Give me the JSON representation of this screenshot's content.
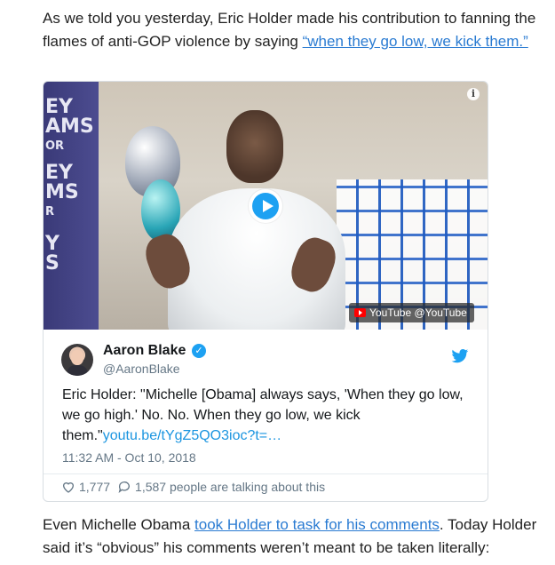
{
  "article": {
    "p1_before": "As we told you yesterday, Eric Holder made his contribution to fanning the flames of anti-GOP violence by saying ",
    "p1_link": "“when they go low, we kick them.”",
    "p2_before": "Even Michelle Obama ",
    "p2_link": "took Holder to task for his comments",
    "p2_after": ". Today Holder said it’s “obvious” his comments weren’t meant to be taken literally:"
  },
  "video": {
    "banner_lines": [
      "EY",
      "AMS",
      "OR",
      "EY",
      "MS",
      "R",
      "Y",
      "S"
    ],
    "youtube_label": "YouTube @YouTube",
    "info_glyph": "i"
  },
  "tweet": {
    "author_name": "Aaron Blake",
    "handle": "@AaronBlake",
    "text": "Eric Holder: \"Michelle [Obama] always says, 'When they go low, we go high.' No. No. When they go low, we kick them.\"",
    "link": "youtu.be/tYgZ5QO3ioc?t=…",
    "timestamp": "11:32 AM - Oct 10, 2018",
    "likes": "1,777",
    "talking": "1,587 people are talking about this",
    "verified_glyph": "✓"
  },
  "colors": {
    "link": "#2a7bd2",
    "twitter_blue": "#1da1f2",
    "muted": "#657786"
  },
  "icons": [
    "info-icon",
    "play-icon",
    "youtube-icon",
    "verified-icon",
    "twitter-bird-icon",
    "heart-icon",
    "comment-icon"
  ]
}
